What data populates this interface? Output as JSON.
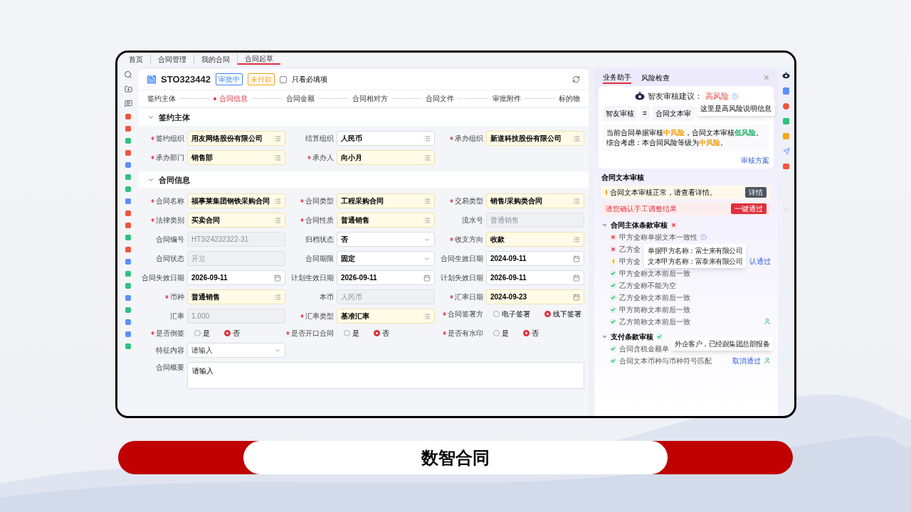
{
  "nav": [
    {
      "label": "首页",
      "selected": false
    },
    {
      "label": "合同管理",
      "selected": false
    },
    {
      "label": "我的合同",
      "selected": false
    },
    {
      "label": "合同起草",
      "selected": true
    }
  ],
  "form": {
    "code": "STO323442",
    "badges": [
      {
        "label": "审批中",
        "color": "#3b82f6"
      },
      {
        "label": "未付款",
        "color": "#f59e0b"
      }
    ],
    "required_only": {
      "label": "只看必填项",
      "checked": false
    },
    "steps": [
      {
        "label": "签约主体",
        "selected": false
      },
      {
        "label": "合同信息",
        "selected": true
      },
      {
        "label": "合同金额",
        "selected": false
      },
      {
        "label": "合同相对方",
        "selected": false
      },
      {
        "label": "合同文件",
        "selected": false
      },
      {
        "label": "审批附件",
        "selected": false
      },
      {
        "label": "标的物",
        "selected": false
      }
    ],
    "sections": [
      {
        "title": "签约主体",
        "expanded": true,
        "rows": [
          [
            {
              "label": "签约组织",
              "required": true,
              "kind": "lookup",
              "value": "用友网络股份有限公司"
            },
            {
              "label": "结算组织",
              "required": false,
              "kind": "lookup",
              "value": "人民币"
            },
            {
              "label": "承办组织",
              "required": true,
              "kind": "lookup",
              "value": "新道科技股份有限公司"
            }
          ],
          [
            {
              "label": "承办部门",
              "required": true,
              "kind": "lookup",
              "value": "销售部"
            },
            {
              "label": "承办人",
              "required": true,
              "kind": "lookup",
              "value": "向小月"
            }
          ]
        ]
      },
      {
        "title": "合同信息",
        "expanded": true,
        "rows": [
          [
            {
              "label": "合同名称",
              "required": true,
              "kind": "lookup",
              "value": "福事莱集团钢铁采购合同"
            },
            {
              "label": "合同类型",
              "required": true,
              "kind": "lookup",
              "value": "工程采购合同"
            },
            {
              "label": "交易类型",
              "required": true,
              "kind": "lookup",
              "value": "销售/采购类合同"
            }
          ],
          [
            {
              "label": "法律类别",
              "required": true,
              "kind": "lookup",
              "value": "买卖合同"
            },
            {
              "label": "合同性质",
              "required": true,
              "kind": "lookup",
              "value": "普通销售"
            },
            {
              "label": "流水号",
              "required": false,
              "kind": "disabled",
              "value": "普通销售"
            }
          ],
          [
            {
              "label": "合同编号",
              "required": false,
              "kind": "disabled",
              "value": "HT3i24232322-31"
            },
            {
              "label": "归档状态",
              "required": false,
              "kind": "select",
              "value": "否"
            },
            {
              "label": "收支方向",
              "required": true,
              "kind": "lookup",
              "value": "收款"
            }
          ],
          [
            {
              "label": "合同状态",
              "required": false,
              "kind": "disabled",
              "value": "开立"
            },
            {
              "label": "合同期限",
              "required": false,
              "kind": "select",
              "value": "固定"
            },
            {
              "label": "合同生效日期",
              "required": false,
              "kind": "date",
              "value": "2024-09-11"
            }
          ],
          [
            {
              "label": "合同失效日期",
              "required": false,
              "kind": "date",
              "value": "2026-09-11"
            },
            {
              "label": "计划生效日期",
              "required": false,
              "kind": "date",
              "value": "2026-09-11"
            },
            {
              "label": "计划失效日期",
              "required": false,
              "kind": "date",
              "value": "2026-09-11"
            }
          ],
          [
            {
              "label": "币种",
              "required": true,
              "kind": "lookup",
              "value": "普通销售"
            },
            {
              "label": "本币",
              "required": false,
              "kind": "disabled",
              "value": "人民币"
            },
            {
              "label": "汇率日期",
              "required": true,
              "kind": "date",
              "value": "2024-09-23"
            }
          ],
          [
            {
              "label": "汇率",
              "required": false,
              "kind": "disabled",
              "value": "1.000"
            },
            {
              "label": "汇率类型",
              "required": true,
              "kind": "lookup",
              "value": "基准汇率"
            },
            {
              "label": "合同签署方",
              "required": true,
              "kind": "radio",
              "options": [
                {
                  "label": "电子签署",
                  "selected": false
                },
                {
                  "label": "线下签署",
                  "selected": true
                }
              ]
            }
          ],
          [
            {
              "label": "是否倒签",
              "required": true,
              "kind": "radio",
              "options": [
                {
                  "label": "是",
                  "selected": false
                },
                {
                  "label": "否",
                  "selected": true
                }
              ]
            },
            {
              "label": "是否开口合同",
              "required": true,
              "kind": "radio",
              "options": [
                {
                  "label": "是",
                  "selected": false
                },
                {
                  "label": "否",
                  "selected": true
                }
              ]
            },
            {
              "label": "是否有水印",
              "required": true,
              "kind": "radio",
              "options": [
                {
                  "label": "是",
                  "selected": false
                },
                {
                  "label": "否",
                  "selected": true
                }
              ]
            }
          ],
          [
            {
              "label": "特征内容",
              "required": false,
              "kind": "select",
              "placeholder": "请输入"
            }
          ],
          [
            {
              "label": "合同概要",
              "required": false,
              "kind": "textarea",
              "placeholder": "请输入"
            }
          ]
        ]
      }
    ]
  },
  "assistant": {
    "tabs": [
      {
        "label": "业务助手",
        "selected": true
      },
      {
        "label": "风险检查",
        "selected": false
      }
    ],
    "close": "×",
    "verdict_label": "智友审核建议：",
    "verdict": "高风险",
    "verdict_tip": "这里是高风险说明信息",
    "chips": [
      "智友审核",
      "=",
      "合同文本审"
    ],
    "summary": [
      {
        "text": "当前合同单据审核"
      },
      {
        "text": "中风险",
        "color": "#f59e0b"
      },
      {
        "text": "，合同文本审核"
      },
      {
        "text": "低风险",
        "color": "#22b46a"
      },
      {
        "text": "。综合考虑：本合同风险等级为"
      },
      {
        "text": "中风险",
        "color": "#f59e0b"
      },
      {
        "text": "。"
      }
    ],
    "plan_link": "审核方案",
    "text_review_title": "合同文本审核",
    "notice": {
      "text": "合同文本审核正常，请查看详情。",
      "button": "详情"
    },
    "confirm": {
      "text": "请您确认手工调整结果",
      "button": "一键通过"
    },
    "groups": [
      {
        "title": "合同主体条款审核",
        "kind": "fail",
        "expanded": true,
        "items": [
          {
            "text": "甲方全称单据文本一致性",
            "kind": "fail",
            "help": true
          },
          {
            "text": "乙方全",
            "kind": "fail",
            "tip": [
              "单据甲方名称：富士来有限公司",
              "文本甲方名称：富泰来有限公司"
            ]
          },
          {
            "text": "甲方全",
            "kind": "warn",
            "action": "认通过"
          },
          {
            "text": "甲方全称文本前后一致",
            "kind": "pass"
          },
          {
            "text": "乙方全称不能为空",
            "kind": "pass"
          },
          {
            "text": "乙方全称文本前后一致",
            "kind": "pass"
          },
          {
            "text": "甲方简称文本前后一致",
            "kind": "pass"
          },
          {
            "text": "乙方简称文本前后一致",
            "kind": "pass",
            "person": true
          }
        ]
      },
      {
        "title": "支付条款审核",
        "kind": "pass",
        "expanded": true,
        "items": [
          {
            "text": "合同含税金额单",
            "kind": "pass",
            "tip": [
              "外企客户，已经跟集团总部报备"
            ]
          },
          {
            "text": "合同文本币种与币种符号匹配",
            "kind": "pass",
            "action": "取消通过",
            "person": true
          }
        ]
      }
    ]
  },
  "banner": "数智合同"
}
